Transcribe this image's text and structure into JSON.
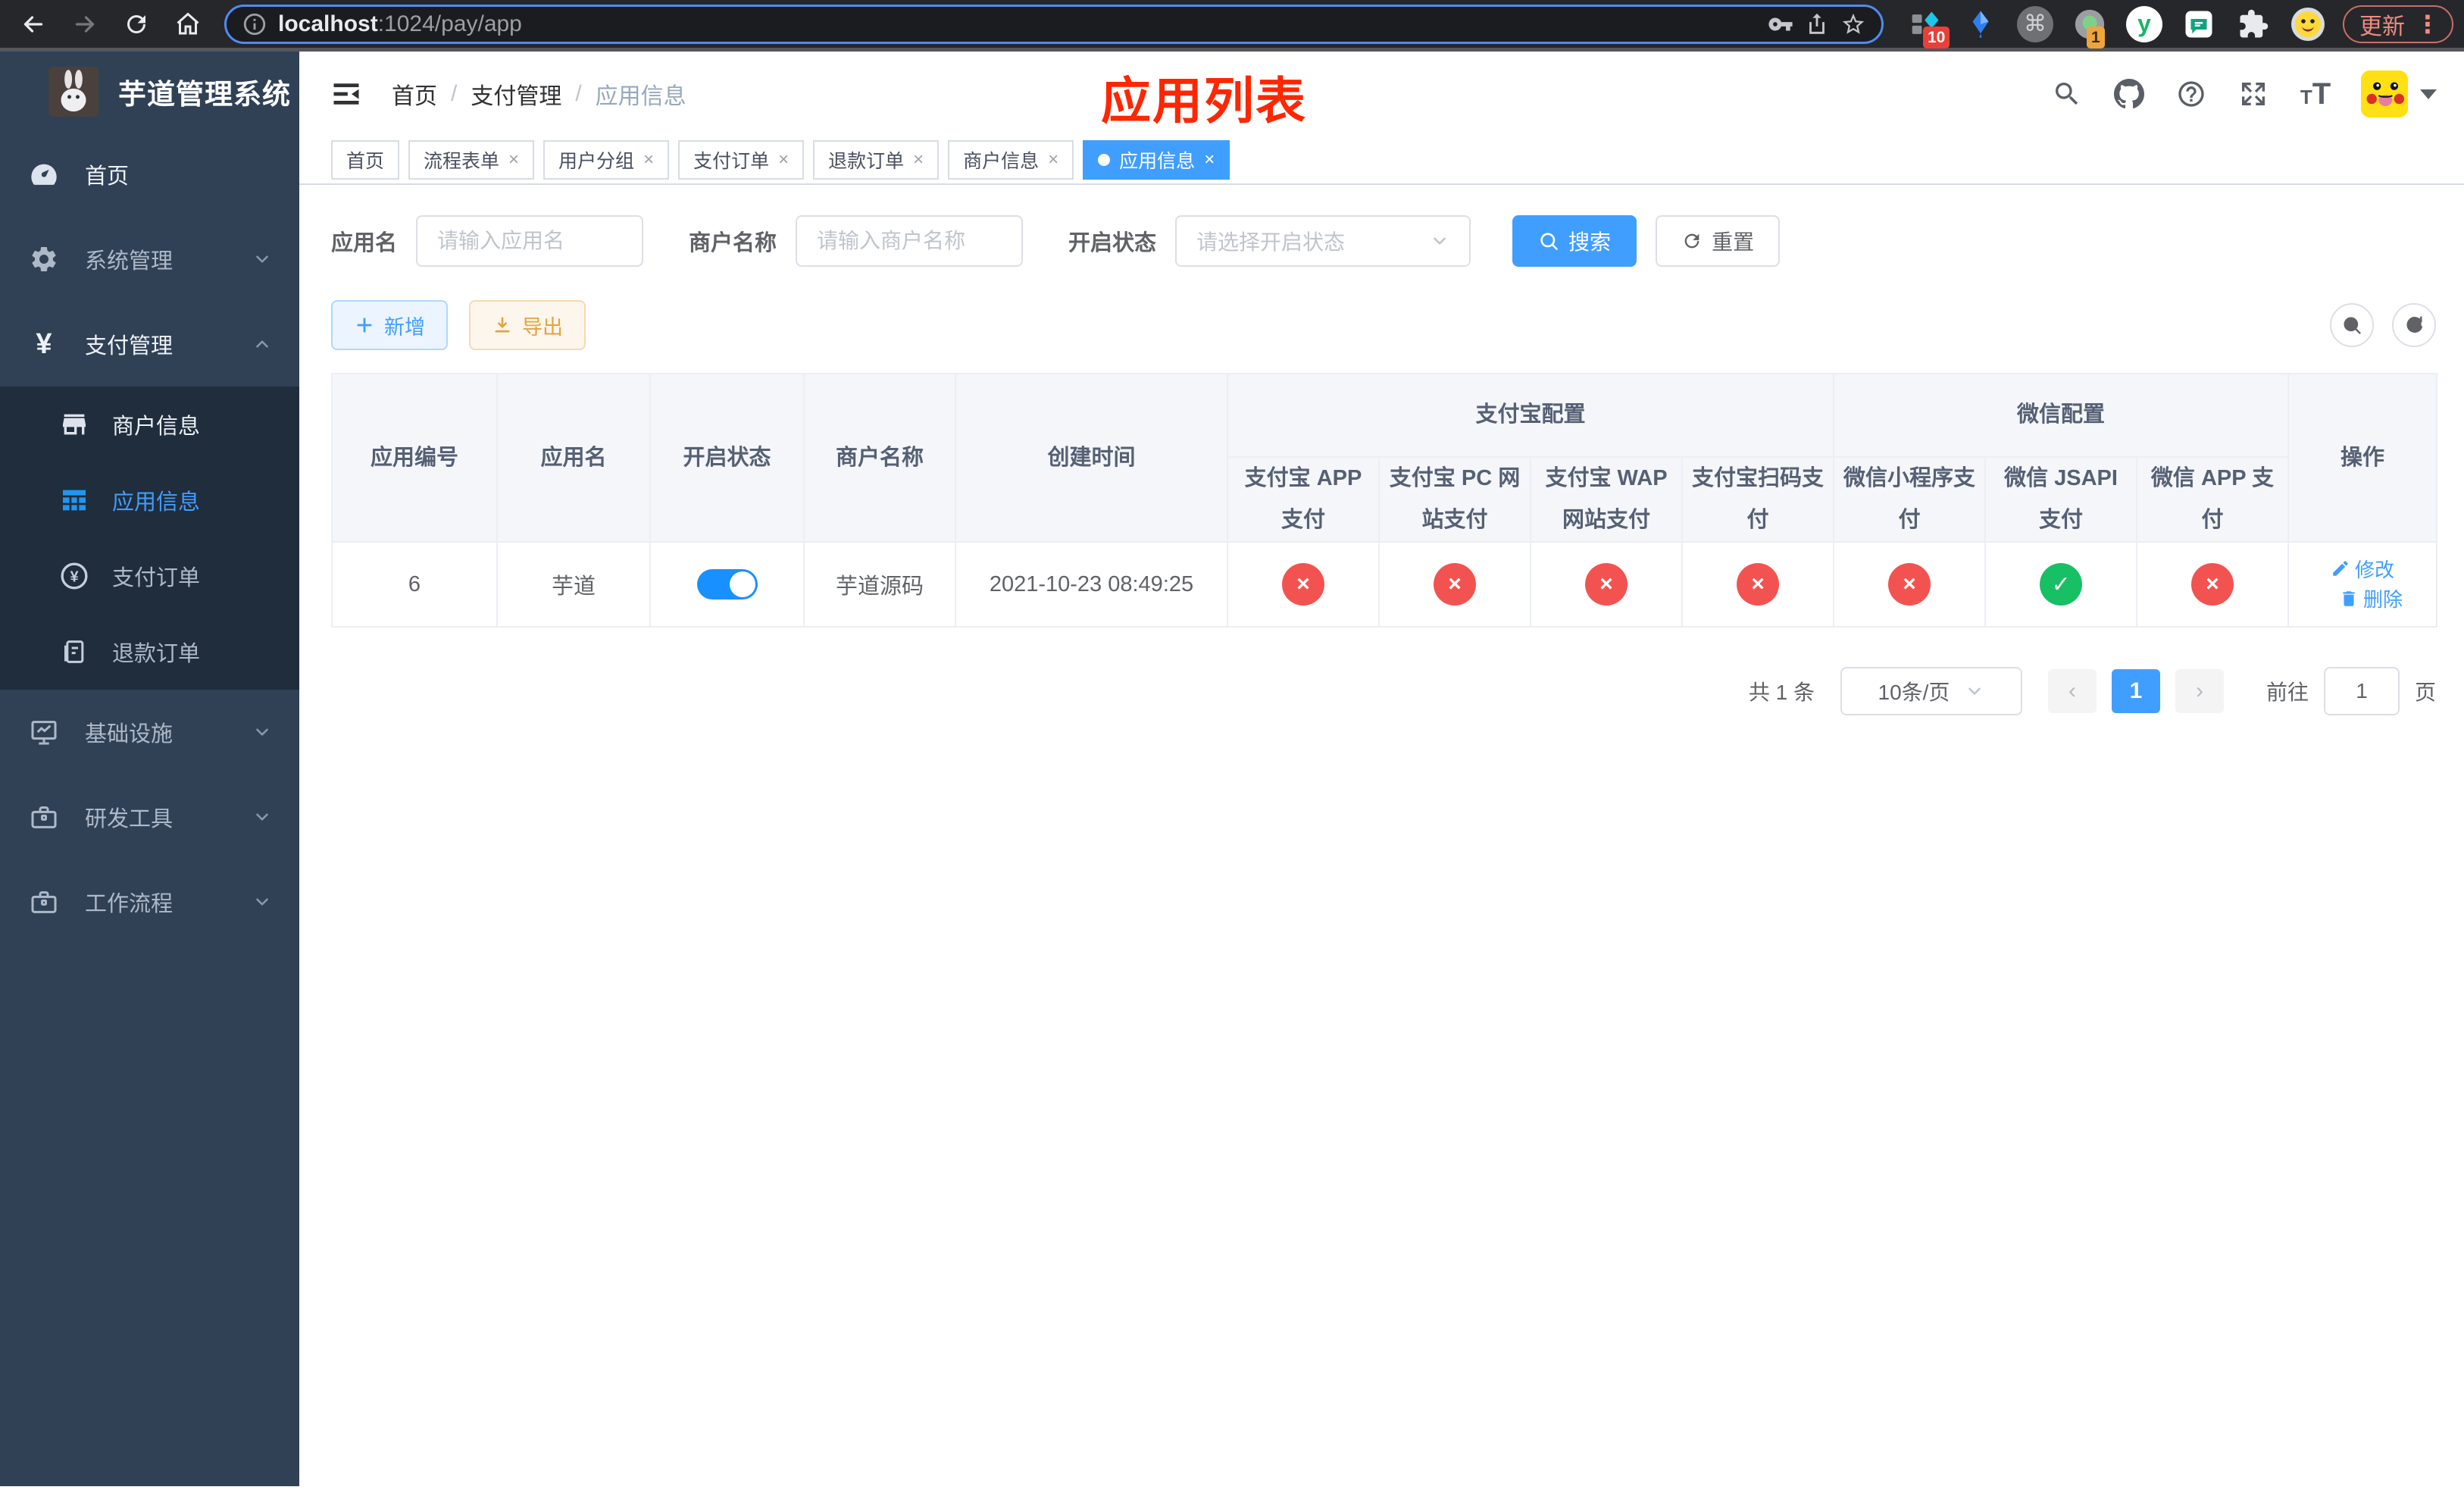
{
  "browser": {
    "url_host": "localhost",
    "url_rest": ":1024/pay/app",
    "ext_badge_blue_diamond": "10",
    "ext_badge_green_dot": "1",
    "update_label": "更新"
  },
  "annotation": {
    "title": "应用列表",
    "color": "#ff2600"
  },
  "sidebar": {
    "logo_title": "芋道管理系统",
    "items": [
      {
        "label": "首页"
      },
      {
        "label": "系统管理"
      },
      {
        "label": "支付管理"
      },
      {
        "label": "商户信息"
      },
      {
        "label": "应用信息"
      },
      {
        "label": "支付订单"
      },
      {
        "label": "退款订单"
      },
      {
        "label": "基础设施"
      },
      {
        "label": "研发工具"
      },
      {
        "label": "工作流程"
      }
    ]
  },
  "header": {
    "breadcrumb": [
      "首页",
      "支付管理",
      "应用信息"
    ]
  },
  "tabs": [
    {
      "label": "首页"
    },
    {
      "label": "流程表单"
    },
    {
      "label": "用户分组"
    },
    {
      "label": "支付订单"
    },
    {
      "label": "退款订单"
    },
    {
      "label": "商户信息"
    },
    {
      "label": "应用信息"
    }
  ],
  "filters": {
    "app_name_label": "应用名",
    "app_name_placeholder": "请输入应用名",
    "merchant_label": "商户名称",
    "merchant_placeholder": "请输入商户名称",
    "status_label": "开启状态",
    "status_placeholder": "请选择开启状态",
    "search_label": "搜索",
    "reset_label": "重置"
  },
  "toolbar": {
    "add_label": "新增",
    "export_label": "导出"
  },
  "table": {
    "simple_headers": [
      "应用编号",
      "应用名",
      "开启状态",
      "商户名称",
      "创建时间"
    ],
    "group_headers": [
      {
        "label": "支付宝配置"
      },
      {
        "label": "微信配置"
      }
    ],
    "sub_headers": [
      "支付宝 APP 支付",
      "支付宝 PC 网站支付",
      "支付宝 WAP 网站支付",
      "支付宝扫码支付",
      "微信小程序支付",
      "微信 JSAPI 支付",
      "微信 APP 支付"
    ],
    "ops_header": "操作",
    "rows": [
      {
        "id": "6",
        "name": "芋道",
        "enabled": true,
        "merchant": "芋道源码",
        "created": "2021-10-23 08:49:25",
        "statuses": [
          "no",
          "no",
          "no",
          "no",
          "no",
          "yes",
          "no"
        ],
        "edit_label": "修改",
        "delete_label": "删除"
      }
    ]
  },
  "pagination": {
    "total_label": "共 1 条",
    "page_size": "10条/页",
    "current_page": "1",
    "goto_label": "前往",
    "goto_value": "1",
    "page_label": "页"
  },
  "colors": {
    "accent_blue": "#409eff",
    "toggle_blue": "#1890ff",
    "success_green": "#17c064",
    "danger_red": "#f35350",
    "warning_orange": "#e6a23c",
    "sidebar_bg": "#304156",
    "submenu_bg": "#1f2d3d",
    "annotation_red": "#ff2600"
  }
}
